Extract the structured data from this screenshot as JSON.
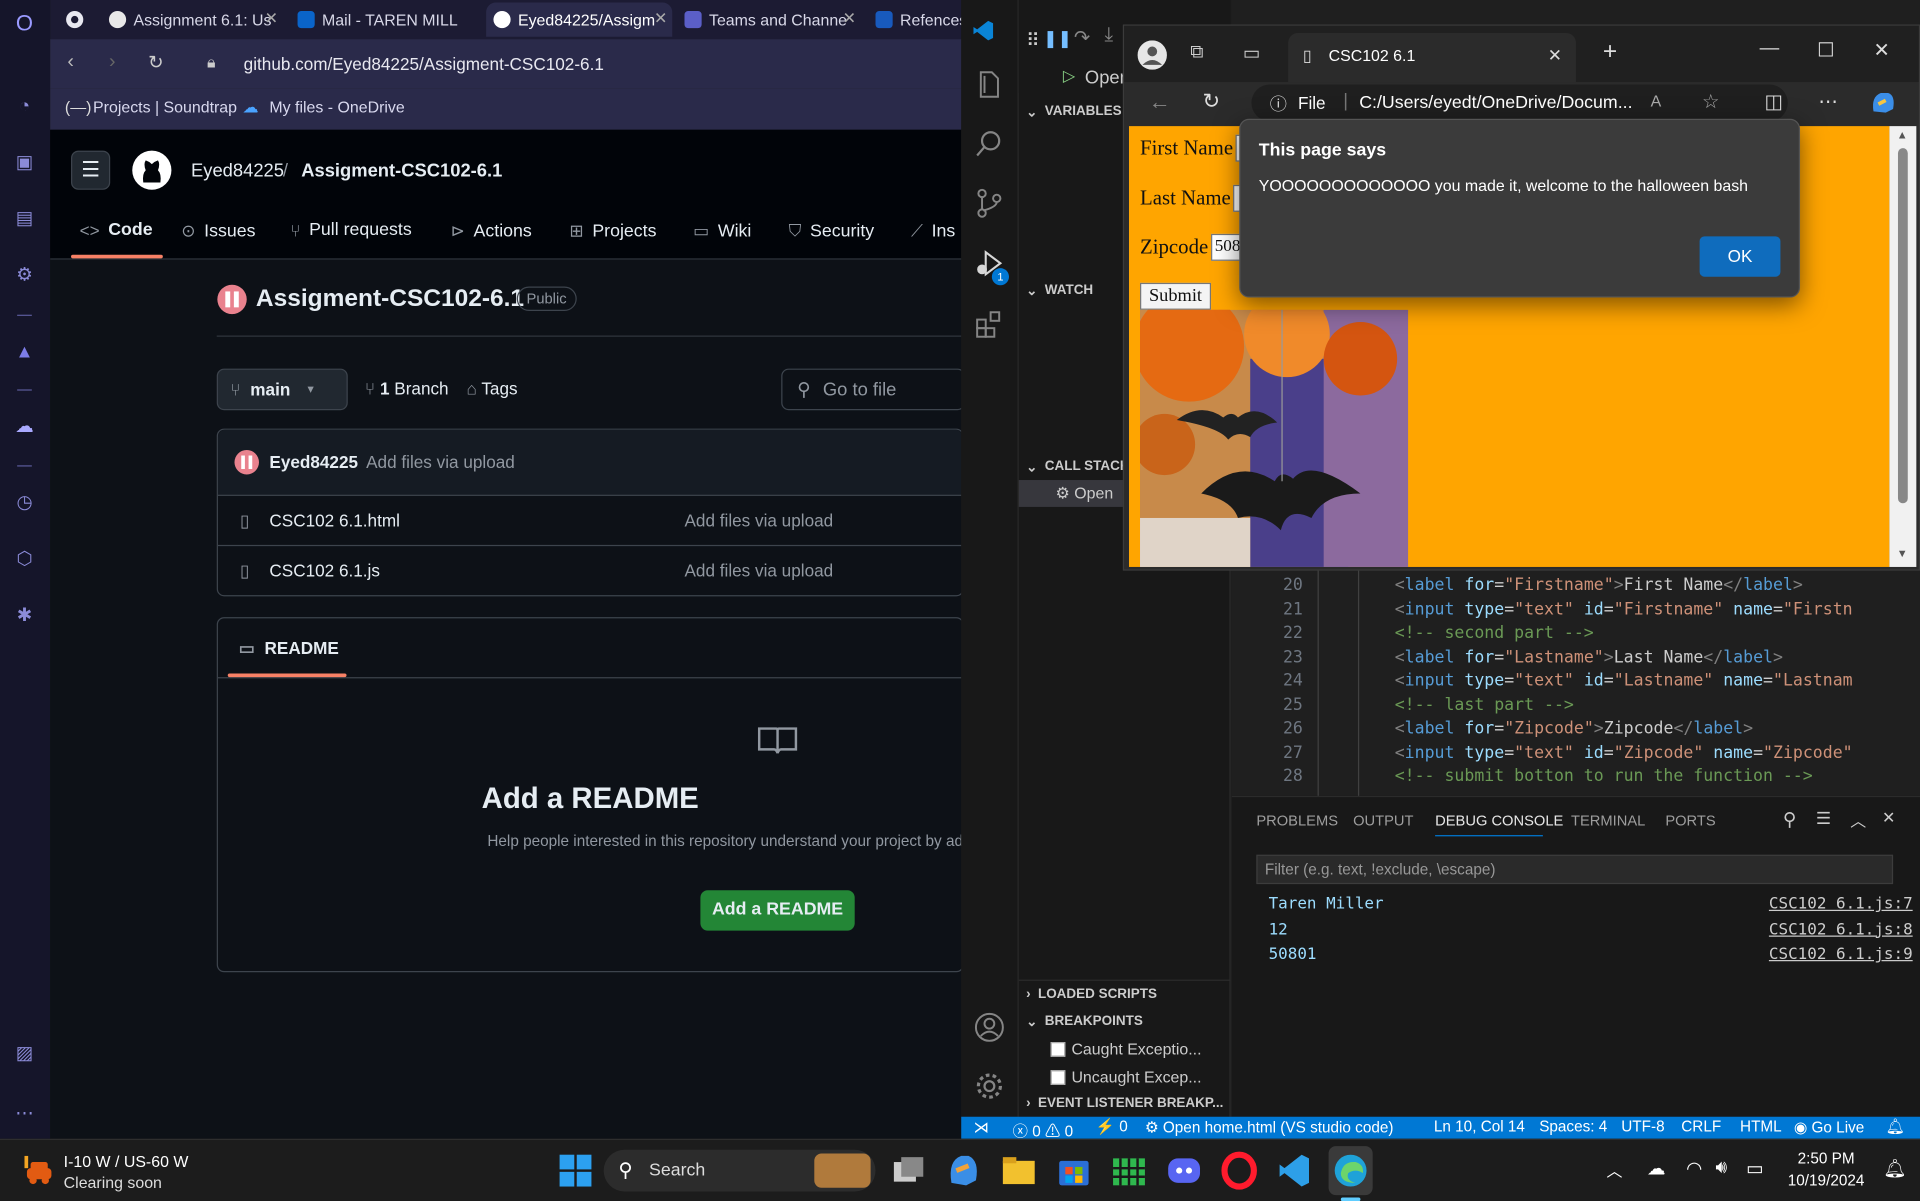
{
  "opera_browser": {
    "tabs": [
      {
        "label": "Assignment 6.1: Us"
      },
      {
        "label": "Mail - TAREN MILL"
      },
      {
        "label": "Eyed84225/Assigm"
      },
      {
        "label": "Teams and Channe"
      },
      {
        "label": "Refences"
      }
    ],
    "url": "github.com/Eyed84225/Assigment-CSC102-6.1",
    "bookmarks": [
      {
        "label": "Projects | Soundtrap"
      },
      {
        "label": "My files - OneDrive"
      }
    ]
  },
  "github": {
    "owner": "Eyed84225",
    "separator": "/",
    "repo": "Assigment-CSC102-6.1",
    "nav": [
      "Code",
      "Issues",
      "Pull requests",
      "Actions",
      "Projects",
      "Wiki",
      "Security",
      "Ins"
    ],
    "visibility": "Public",
    "branch": "main",
    "branch_count": "1",
    "branch_label": "Branch",
    "tags_label": "Tags",
    "goto_placeholder": "Go to file",
    "commit_author": "Eyed84225",
    "commit_message": "Add files via upload",
    "files": [
      {
        "name": "CSC102 6.1.html",
        "message": "Add files via upload"
      },
      {
        "name": "CSC102 6.1.js",
        "message": "Add files via upload"
      }
    ],
    "readme_tab": "README",
    "readme_title": "Add a README",
    "readme_text": "Help people interested in this repository understand your project by add",
    "readme_button": "Add a README"
  },
  "vscode": {
    "run_label": "Open",
    "sections": {
      "variables": "VARIABLES",
      "watch": "WATCH",
      "call_stack": "CALL STACK",
      "call_stack_item": "Open",
      "loaded_scripts": "LOADED SCRIPTS",
      "breakpoints": "BREAKPOINTS",
      "caught": "Caught Exceptio...",
      "uncaught": "Uncaught Excep...",
      "event_listener": "EVENT LISTENER BREAKP..."
    },
    "badge": "1",
    "code_lines": [
      {
        "n": "20",
        "indent": "",
        "parts": [
          [
            "tg",
            "<"
          ],
          [
            "kw",
            "label"
          ],
          [
            "",
            ""
          ],
          [
            "at",
            " for"
          ],
          [
            "",
            "="
          ],
          [
            "st",
            "\"Firstname\""
          ],
          [
            "tg",
            ">"
          ],
          [
            "",
            "First Name"
          ],
          [
            "tg",
            "</"
          ],
          [
            "kw",
            "label"
          ],
          [
            "tg",
            ">"
          ]
        ]
      },
      {
        "n": "21",
        "parts": [
          [
            "tg",
            "<"
          ],
          [
            "kw",
            "input"
          ],
          [
            "at",
            " type"
          ],
          [
            "",
            "="
          ],
          [
            "st",
            "\"text\""
          ],
          [
            "at",
            " id"
          ],
          [
            "",
            "="
          ],
          [
            "st",
            "\"Firstname\""
          ],
          [
            "at",
            " name"
          ],
          [
            "",
            "="
          ],
          [
            "st",
            "\"Firstn"
          ]
        ]
      },
      {
        "n": "22",
        "parts": [
          [
            "cm",
            "<!-- second part -->"
          ]
        ]
      },
      {
        "n": "23",
        "parts": [
          [
            "tg",
            "<"
          ],
          [
            "kw",
            "label"
          ],
          [
            "at",
            " for"
          ],
          [
            "",
            "="
          ],
          [
            "st",
            "\"Lastname\""
          ],
          [
            "tg",
            ">"
          ],
          [
            "",
            "Last Name"
          ],
          [
            "tg",
            "</"
          ],
          [
            "kw",
            "label"
          ],
          [
            "tg",
            ">"
          ]
        ]
      },
      {
        "n": "24",
        "parts": [
          [
            "tg",
            "<"
          ],
          [
            "kw",
            "input"
          ],
          [
            "at",
            " type"
          ],
          [
            "",
            "="
          ],
          [
            "st",
            "\"text\""
          ],
          [
            "at",
            " id"
          ],
          [
            "",
            "="
          ],
          [
            "st",
            "\"Lastname\""
          ],
          [
            "at",
            " name"
          ],
          [
            "",
            "="
          ],
          [
            "st",
            "\"Lastnam"
          ]
        ]
      },
      {
        "n": "25",
        "parts": [
          [
            "cm",
            "<!-- last part -->"
          ]
        ]
      },
      {
        "n": "26",
        "parts": [
          [
            "tg",
            "<"
          ],
          [
            "kw",
            "label"
          ],
          [
            "at",
            " for"
          ],
          [
            "",
            "="
          ],
          [
            "st",
            "\"Zipcode\""
          ],
          [
            "tg",
            ">"
          ],
          [
            "",
            "Zipcode"
          ],
          [
            "tg",
            "</"
          ],
          [
            "kw",
            "label"
          ],
          [
            "tg",
            ">"
          ]
        ]
      },
      {
        "n": "27",
        "parts": [
          [
            "tg",
            "<"
          ],
          [
            "kw",
            "input"
          ],
          [
            "at",
            " type"
          ],
          [
            "",
            "="
          ],
          [
            "st",
            "\"text\""
          ],
          [
            "at",
            " id"
          ],
          [
            "",
            "="
          ],
          [
            "st",
            "\"Zipcode\""
          ],
          [
            "at",
            " name"
          ],
          [
            "",
            "="
          ],
          [
            "st",
            "\"Zipcode\""
          ]
        ]
      },
      {
        "n": "28",
        "parts": [
          [
            "cm",
            "<!-- submit botton to run the function -->"
          ]
        ]
      }
    ],
    "panel_tabs": [
      "PROBLEMS",
      "OUTPUT",
      "DEBUG CONSOLE",
      "TERMINAL",
      "PORTS"
    ],
    "filter_placeholder": "Filter (e.g. text, !exclude, \\escape)",
    "console": [
      {
        "value": "Taren Miller",
        "source": "CSC102 6.1.js:7"
      },
      {
        "value": "12",
        "source": "CSC102 6.1.js:8"
      },
      {
        "value": "50801",
        "source": "CSC102 6.1.js:9"
      }
    ],
    "status": {
      "errors": "0",
      "warnings": "0",
      "ports": "0",
      "debug": "Open home.html (VS studio code)",
      "position": "Ln 10, Col 14",
      "spaces": "Spaces: 4",
      "encoding": "UTF-8",
      "eol": "CRLF",
      "language": "HTML",
      "golive": "Go Live"
    }
  },
  "edge": {
    "tab_title": "CSC102 6.1",
    "file_label": "File",
    "path": "C:/Users/eyedt/OneDrive/Docum...",
    "form": {
      "first": "First Name",
      "last": "Last Name",
      "zip": "Zipcode",
      "zip_value": "508",
      "submit": "Submit"
    },
    "dialog": {
      "title": "This page says",
      "message": "YOOOOOOOOOOOOO you made it, welcome to the halloween bash",
      "ok": "OK"
    }
  },
  "taskbar": {
    "weather_title": "I-10 W / US-60 W",
    "weather_sub": "Clearing soon",
    "search": "Search",
    "time": "2:50 PM",
    "date": "10/19/2024"
  }
}
